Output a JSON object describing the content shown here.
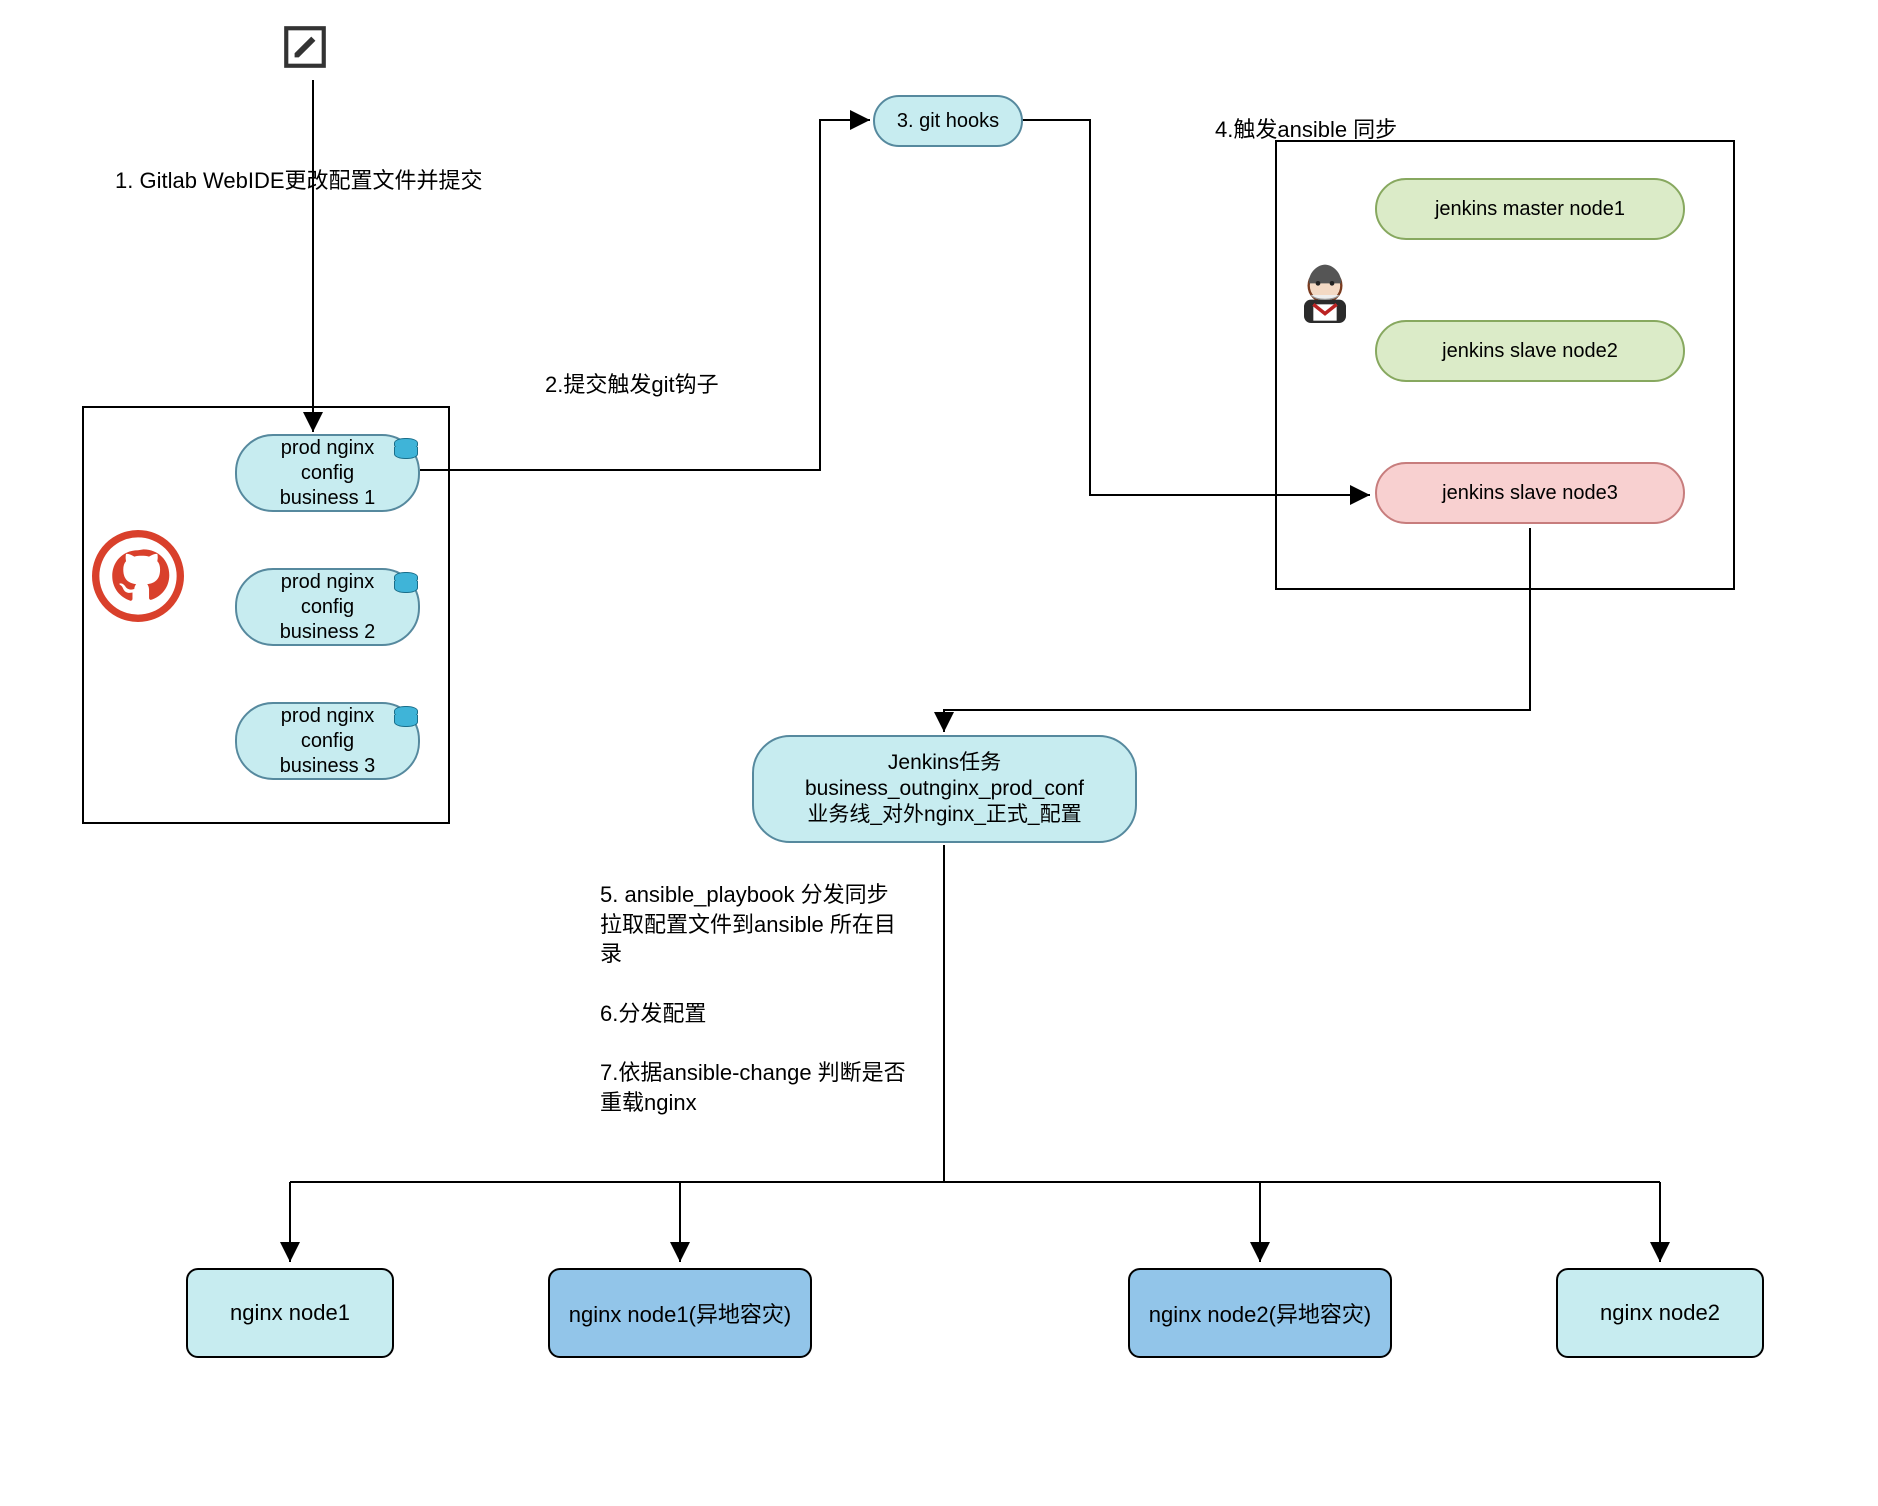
{
  "labels": {
    "step1": "1. Gitlab WebIDE更改配置文件并提交",
    "step2": "2.提交触发git钩子",
    "step3": "3. git hooks",
    "step4": "4.触发ansible 同步",
    "step5_7": "5. ansible_playbook 分发同步\n拉取配置文件到ansible 所在目\n录\n\n6.分发配置\n\n7.依据ansible-change 判断是否\n重载nginx"
  },
  "gitlab_group": {
    "items": [
      "prod nginx\nconfig\nbusiness 1",
      "prod nginx\nconfig\nbusiness 2",
      "prod nginx\nconfig\nbusiness 3"
    ]
  },
  "jenkins_group": {
    "items": [
      "jenkins master node1",
      "jenkins slave node2",
      "jenkins slave node3"
    ]
  },
  "jenkins_task": "Jenkins任务\nbusiness_outnginx_prod_conf\n业务线_对外nginx_正式_配置",
  "nginx_nodes": [
    {
      "label": "nginx node1",
      "style": "light"
    },
    {
      "label": "nginx node1(异地容灾)",
      "style": "dark"
    },
    {
      "label": "nginx node2(异地容灾)",
      "style": "dark"
    },
    {
      "label": "nginx node2",
      "style": "light"
    }
  ]
}
